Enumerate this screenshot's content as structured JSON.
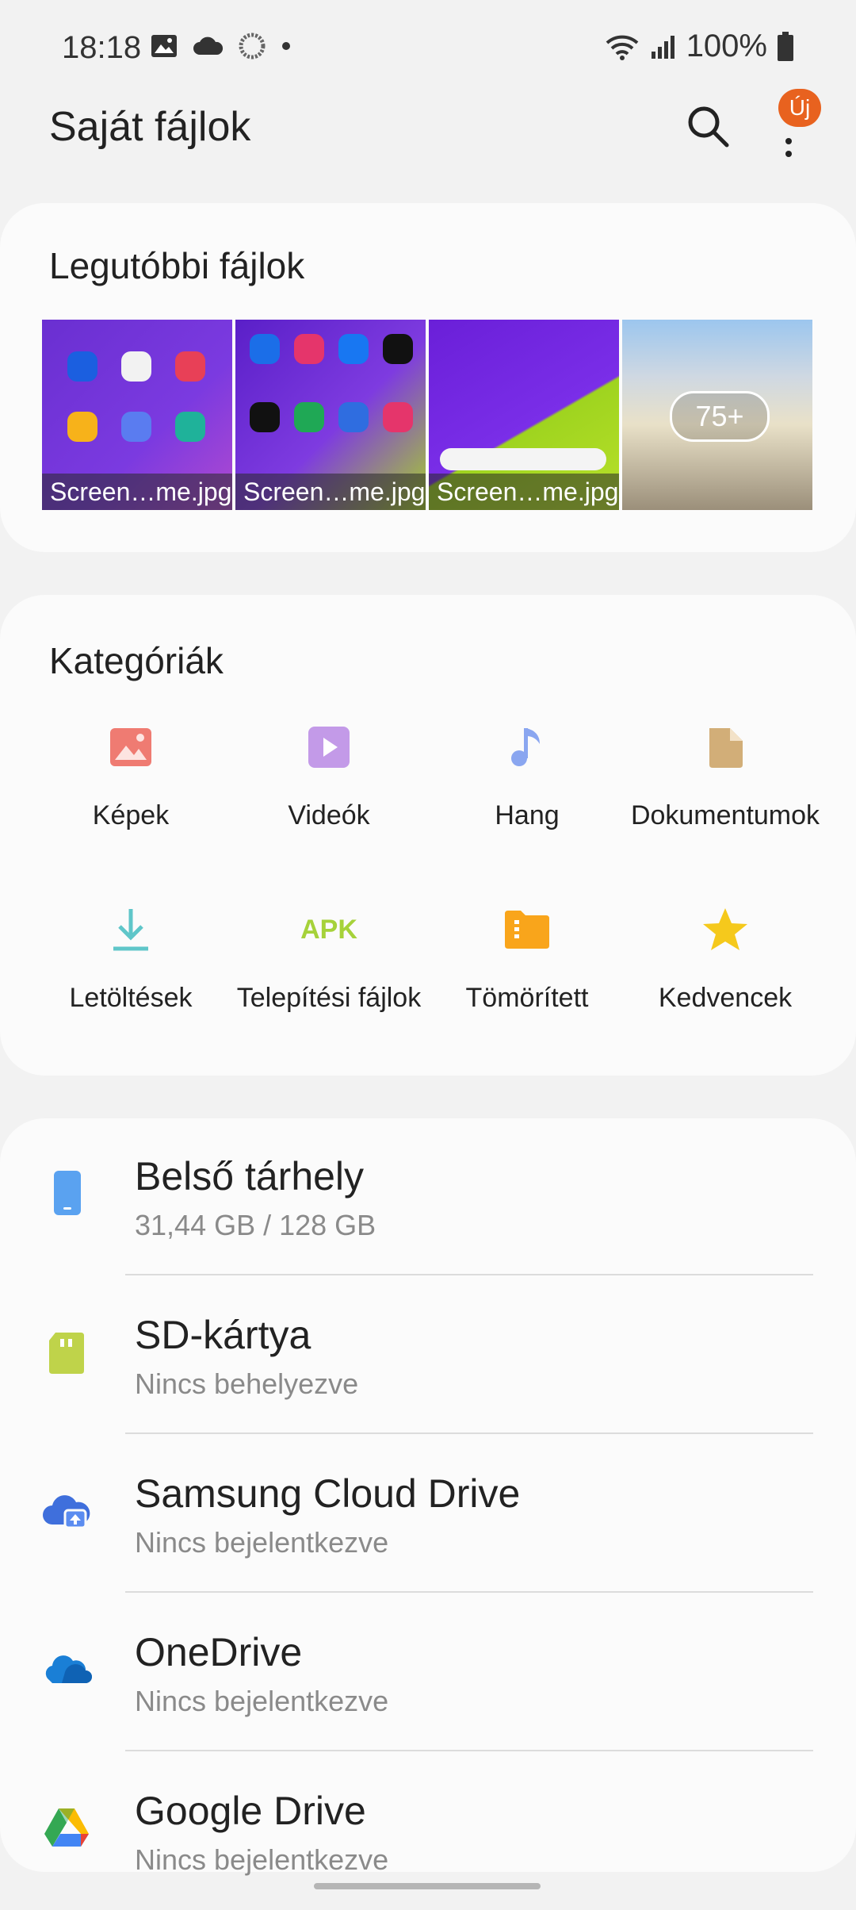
{
  "status_bar": {
    "time": "18:18",
    "battery": "100%",
    "left_icons": [
      "gallery-icon",
      "cloud-icon",
      "sync-icon",
      "dot-icon"
    ],
    "right_icons": [
      "wifi-icon",
      "signal-icon",
      "battery-icon"
    ]
  },
  "header": {
    "title": "Saját fájlok",
    "badge": "Új"
  },
  "recent": {
    "title": "Legutóbbi fájlok",
    "items": [
      {
        "caption": "Screen…me.jpg"
      },
      {
        "caption": "Screen…me.jpg"
      },
      {
        "caption": "Screen…me.jpg"
      },
      {
        "caption": "75+"
      }
    ]
  },
  "categories": {
    "title": "Kategóriák",
    "items": [
      {
        "label": "Képek",
        "icon": "image-icon",
        "color": "#ef7b72"
      },
      {
        "label": "Videók",
        "icon": "video-icon",
        "color": "#c39ae8"
      },
      {
        "label": "Hang",
        "icon": "music-note-icon",
        "color": "#8aa6f0"
      },
      {
        "label": "Dokumentumok",
        "icon": "document-icon",
        "color": "#d2ae78"
      },
      {
        "label": "Letöltések",
        "icon": "download-icon",
        "color": "#5fc6c9"
      },
      {
        "label": "Telepítési fájlok",
        "icon": "apk-icon",
        "color": "#a6d23a",
        "icon_text": "APK"
      },
      {
        "label": "Tömörített",
        "icon": "zip-folder-icon",
        "color": "#f9a51b"
      },
      {
        "label": "Kedvencek",
        "icon": "star-icon",
        "color": "#f5c91c"
      }
    ]
  },
  "storage": {
    "items": [
      {
        "title": "Belső tárhely",
        "subtitle": "31,44 GB / 128 GB",
        "icon": "phone-icon",
        "color": "#5aa2f0"
      },
      {
        "title": "SD-kártya",
        "subtitle": "Nincs behelyezve",
        "icon": "sd-card-icon",
        "color": "#bfd34a"
      },
      {
        "title": "Samsung Cloud Drive",
        "subtitle": "Nincs bejelentkezve",
        "icon": "cloud-upload-icon",
        "color": "#3f6fdc"
      },
      {
        "title": "OneDrive",
        "subtitle": "Nincs bejelentkezve",
        "icon": "onedrive-icon",
        "color": "#1a7fd6"
      },
      {
        "title": "Google Drive",
        "subtitle": "Nincs bejelentkezve",
        "icon": "google-drive-icon",
        "color": "#34a853"
      }
    ]
  }
}
